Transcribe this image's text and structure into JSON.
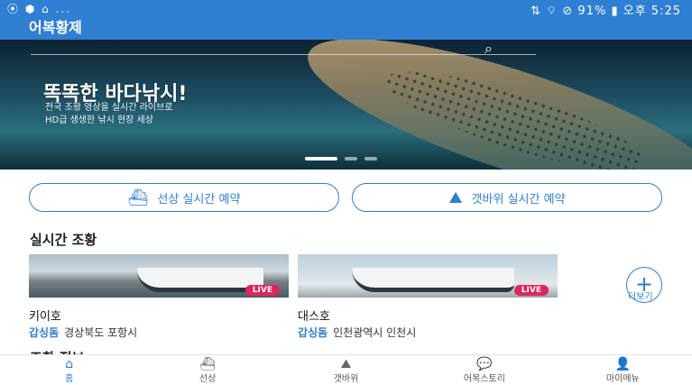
{
  "status": {
    "left_icons": "⦿ ⬢ ⌂ ...",
    "right": "⇅ ⌔ ⊘ 91% ▮ 오후 5:25"
  },
  "app": {
    "title": "어복황제"
  },
  "banner": {
    "headline": "똑똑한 바다낚시!",
    "sub1": "전국 조황 영상을 실시간 라이브로",
    "sub2": "HD급 생생한 낚시 현장 세상",
    "slides": 3,
    "active_slide": 1
  },
  "reserve": {
    "boat_label": "선상 실시간 예약",
    "rock_label": "갯바위 실시간 예약"
  },
  "live_section": {
    "title": "실시간 조황",
    "cards": [
      {
        "name": "키이호",
        "type": "갑싱돔",
        "location": "경상북도 포항시",
        "badge": "LIVE"
      },
      {
        "name": "대스호",
        "type": "갑싱돔",
        "location": "인천광역시 인천시",
        "badge": "LIVE"
      }
    ],
    "more_label": "더보기"
  },
  "next_section": {
    "title": "조황 정보"
  },
  "nav": {
    "items": [
      {
        "label": "홈",
        "icon": "home-icon",
        "glyph": "⌂"
      },
      {
        "label": "선상",
        "icon": "boat-icon",
        "glyph": "⛴"
      },
      {
        "label": "갯바위",
        "icon": "rock-icon",
        "glyph": "⛰"
      },
      {
        "label": "어복스토리",
        "icon": "chat-icon",
        "glyph": "💬"
      },
      {
        "label": "마이메뉴",
        "icon": "user-icon",
        "glyph": "👤"
      }
    ]
  },
  "colors": {
    "primary": "#2f7fd3",
    "live": "#e0245e"
  }
}
